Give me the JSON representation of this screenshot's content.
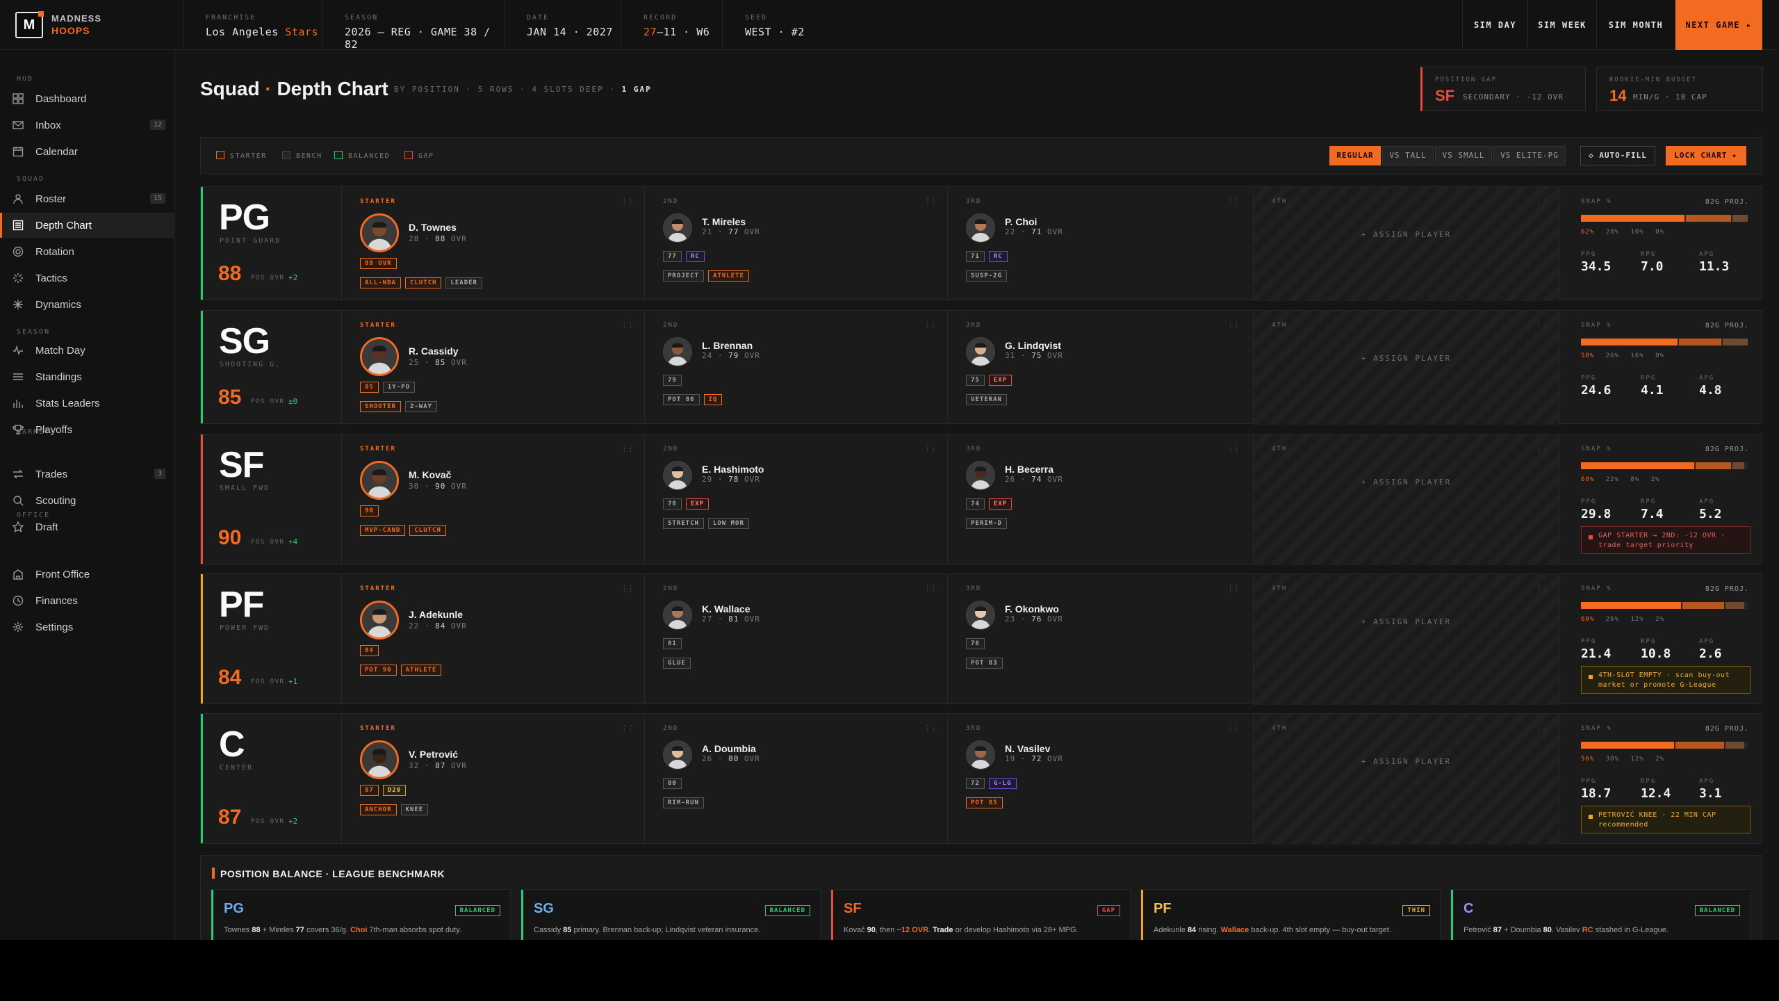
{
  "brand": {
    "line1": "MADNESS",
    "line2": "HOOPS",
    "logo": "M"
  },
  "meta": [
    {
      "label": "FRANCHISE",
      "value": "Los Angeles ",
      "accent": "Stars"
    },
    {
      "label": "SEASON",
      "value": "2026 — REG · GAME 38 / 82",
      "accent": ""
    },
    {
      "label": "DATE",
      "value": "JAN 14 · 2027",
      "accent": ""
    },
    {
      "label": "RECORD",
      "value": "—11 · W6",
      "accent": "27"
    },
    {
      "label": "SEED",
      "value": "WEST · #2",
      "accent": ""
    }
  ],
  "topbuttons": {
    "sim_day": "SIM DAY",
    "sim_week": "SIM WEEK",
    "sim_month": "SIM MONTH",
    "next_game": "NEXT GAME ▸"
  },
  "sidebar": {
    "sections": [
      "HUB",
      "SQUAD",
      "SEASON",
      "MARKET",
      "OFFICE"
    ],
    "items": [
      {
        "label": "Dashboard",
        "icon": "grid-icon",
        "count": ""
      },
      {
        "label": "Inbox",
        "icon": "mail-icon",
        "count": "12"
      },
      {
        "label": "Calendar",
        "icon": "calendar-icon",
        "count": ""
      },
      {
        "label": "Roster",
        "icon": "person-icon",
        "count": "15"
      },
      {
        "label": "Depth Chart",
        "icon": "list-icon",
        "count": ""
      },
      {
        "label": "Rotation",
        "icon": "rotation-icon",
        "count": ""
      },
      {
        "label": "Tactics",
        "icon": "tactics-icon",
        "count": ""
      },
      {
        "label": "Dynamics",
        "icon": "dynamics-icon",
        "count": ""
      },
      {
        "label": "Match Day",
        "icon": "pulse-icon",
        "count": ""
      },
      {
        "label": "Standings",
        "icon": "lines-icon",
        "count": ""
      },
      {
        "label": "Stats Leaders",
        "icon": "bars-icon",
        "count": ""
      },
      {
        "label": "Playoffs",
        "icon": "trophy-icon",
        "count": ""
      },
      {
        "label": "Trades",
        "icon": "swap-icon",
        "count": "3"
      },
      {
        "label": "Scouting",
        "icon": "search-icon",
        "count": ""
      },
      {
        "label": "Draft",
        "icon": "star-icon",
        "count": ""
      },
      {
        "label": "Front Office",
        "icon": "building-icon",
        "count": ""
      },
      {
        "label": "Finances",
        "icon": "clock-icon",
        "count": ""
      },
      {
        "label": "Settings",
        "icon": "gear-icon",
        "count": ""
      }
    ]
  },
  "header": {
    "title": "Squad",
    "title2": "Depth Chart",
    "sub": "BY POSITION · 5 ROWS · 4 SLOTS DEEP · ",
    "sub_b": "1 GAP"
  },
  "kpis": [
    {
      "label": "POSITION GAP",
      "value": "SF",
      "sub": "SECONDARY · -12 OVR"
    },
    {
      "label": "ROOKIE-MIN BUDGET",
      "value": "14",
      "sub": "MIN/G · 18 CAP"
    }
  ],
  "legend": {
    "starter": "STARTER",
    "bench": "BENCH",
    "balanced": "BALANCED",
    "gap": "GAP"
  },
  "views": [
    "REGULAR",
    "VS TALL",
    "VS SMALL",
    "VS ELITE-PG"
  ],
  "autofill": "◇ AUTO-FILL",
  "lock": "LOCK CHART ▸",
  "slot_labels": {
    "starter": "STARTER",
    "s2": "2ND",
    "s3": "3RD",
    "s4": "4TH",
    "assign": "+ ASSIGN PLAYER",
    "snap": "SNAP %",
    "proj": "82G PROJ.",
    "ppg": "PPG",
    "rpg": "RPG",
    "apg": "APG",
    "ovr_l": "POS OVR"
  },
  "rows": [
    {
      "pos": "PG",
      "name": "POINT GUARD",
      "ovr": "88",
      "delta": "+2",
      "color": "#2ecc71",
      "starter": {
        "name": "D. Townes",
        "meta": "28 · ",
        "ovr": "88",
        "tags1": [
          [
            "88 OVR",
            "o"
          ]
        ],
        "tags2": [
          [
            "ALL-NBA",
            "o"
          ],
          [
            "CLUTCH",
            "o"
          ],
          [
            "LEADER",
            "g"
          ]
        ]
      },
      "second": {
        "name": "T. Mireles",
        "meta": "21 · ",
        "ovr": "77",
        "tags1": [
          [
            "77",
            "g"
          ],
          [
            "RC",
            "p"
          ]
        ],
        "tags2": [
          [
            "PROJECT",
            "g"
          ],
          [
            "ATHLETE",
            "o"
          ]
        ]
      },
      "third": {
        "name": "P. Choi",
        "meta": "22 · ",
        "ovr": "71",
        "tags1": [
          [
            "71",
            "g"
          ],
          [
            "RC",
            "p"
          ]
        ],
        "tags2": [
          [
            "SUSP-2G",
            "g"
          ]
        ]
      },
      "snap": [
        "62%",
        "28%",
        "10%",
        "0%"
      ],
      "snap_fill": [
        0.62,
        0.28,
        0.1
      ],
      "ppg": "34.5",
      "rpg": "7.0",
      "apg": "11.3",
      "alert": "",
      "alert_t": ""
    },
    {
      "pos": "SG",
      "name": "SHOOTING G.",
      "ovr": "85",
      "delta": "±0",
      "color": "#2ecc71",
      "starter": {
        "name": "R. Cassidy",
        "meta": "25 · ",
        "ovr": "85",
        "tags1": [
          [
            "85",
            "o"
          ],
          [
            "1Y-PO",
            "g"
          ]
        ],
        "tags2": [
          [
            "SHOOTER",
            "o"
          ],
          [
            "2-WAY",
            "g"
          ]
        ]
      },
      "second": {
        "name": "L. Brennan",
        "meta": "24 · ",
        "ovr": "79",
        "tags1": [
          [
            "79",
            "g"
          ]
        ],
        "tags2": [
          [
            "POT 86",
            "g"
          ],
          [
            "IQ",
            "o"
          ]
        ]
      },
      "third": {
        "name": "G. Lindqvist",
        "meta": "31 · ",
        "ovr": "75",
        "tags1": [
          [
            "75",
            "g"
          ],
          [
            "EXP",
            "r"
          ]
        ],
        "tags2": [
          [
            "VETERAN",
            "g"
          ]
        ]
      },
      "snap": [
        "58%",
        "26%",
        "16%",
        "0%"
      ],
      "snap_fill": [
        0.58,
        0.26,
        0.16
      ],
      "ppg": "24.6",
      "rpg": "4.1",
      "apg": "4.8",
      "alert": "",
      "alert_t": ""
    },
    {
      "pos": "SF",
      "name": "SMALL FWD",
      "ovr": "90",
      "delta": "+4",
      "color": "#e74c3c",
      "starter": {
        "name": "M. Kovač",
        "meta": "30 · ",
        "ovr": "90",
        "tags1": [
          [
            "90",
            "o"
          ]
        ],
        "tags2": [
          [
            "MVP-CAND",
            "o"
          ],
          [
            "CLUTCH",
            "o"
          ]
        ]
      },
      "second": {
        "name": "E. Hashimoto",
        "meta": "29 · ",
        "ovr": "78",
        "tags1": [
          [
            "78",
            "g"
          ],
          [
            "EXP",
            "r"
          ]
        ],
        "tags2": [
          [
            "STRETCH",
            "g"
          ],
          [
            "LOW MOR",
            "g"
          ]
        ]
      },
      "third": {
        "name": "H. Becerra",
        "meta": "26 · ",
        "ovr": "74",
        "tags1": [
          [
            "74",
            "g"
          ],
          [
            "EXP",
            "r"
          ]
        ],
        "tags2": [
          [
            "PERIM-D",
            "g"
          ]
        ]
      },
      "snap": [
        "68%",
        "22%",
        "8%",
        "2%"
      ],
      "snap_fill": [
        0.68,
        0.22,
        0.08
      ],
      "ppg": "29.8",
      "rpg": "7.4",
      "apg": "5.2",
      "alert": "r",
      "alert_t": "GAP STARTER → 2ND: -12 OVR · trade target priority"
    },
    {
      "pos": "PF",
      "name": "POWER FWD",
      "ovr": "84",
      "delta": "+1",
      "color": "#f2a51e",
      "starter": {
        "name": "J. Adekunle",
        "meta": "22 · ",
        "ovr": "84",
        "tags1": [
          [
            "84",
            "o"
          ]
        ],
        "tags2": [
          [
            "POT 90",
            "o"
          ],
          [
            "ATHLETE",
            "o"
          ]
        ]
      },
      "second": {
        "name": "K. Wallace",
        "meta": "27 · ",
        "ovr": "81",
        "tags1": [
          [
            "81",
            "g"
          ]
        ],
        "tags2": [
          [
            "GLUE",
            "g"
          ]
        ]
      },
      "third": {
        "name": "F. Okonkwo",
        "meta": "23 · ",
        "ovr": "76",
        "tags1": [
          [
            "76",
            "g"
          ]
        ],
        "tags2": [
          [
            "POT 83",
            "g"
          ]
        ]
      },
      "snap": [
        "60%",
        "26%",
        "12%",
        "2%"
      ],
      "snap_fill": [
        0.6,
        0.26,
        0.12
      ],
      "ppg": "21.4",
      "rpg": "10.8",
      "apg": "2.6",
      "alert": "y",
      "alert_t": "4TH-SLOT EMPTY · scan buy-out market or promote G-League"
    },
    {
      "pos": "C",
      "name": "CENTER",
      "ovr": "87",
      "delta": "+2",
      "color": "#2ecc71",
      "starter": {
        "name": "V. Petrović",
        "meta": "32 · ",
        "ovr": "87",
        "tags1": [
          [
            "87",
            "o"
          ],
          [
            "D20",
            "y"
          ]
        ],
        "tags2": [
          [
            "ANCHOR",
            "o"
          ],
          [
            "KNEE",
            "g"
          ]
        ]
      },
      "second": {
        "name": "A. Doumbia",
        "meta": "26 · ",
        "ovr": "80",
        "tags1": [
          [
            "80",
            "g"
          ]
        ],
        "tags2": [
          [
            "RIM-RUN",
            "g"
          ]
        ]
      },
      "third": {
        "name": "N. Vasilev",
        "meta": "19 · ",
        "ovr": "72",
        "tags1": [
          [
            "72",
            "g"
          ],
          [
            "G-LG",
            "p"
          ]
        ],
        "tags2": [
          [
            "POT 85",
            "o"
          ]
        ]
      },
      "snap": [
        "56%",
        "30%",
        "12%",
        "2%"
      ],
      "snap_fill": [
        0.56,
        0.3,
        0.12
      ],
      "ppg": "18.7",
      "rpg": "12.4",
      "apg": "3.1",
      "alert": "y",
      "alert_t": "PETROVIĆ KNEE · 22 MIN CAP recommended"
    }
  ],
  "balance": {
    "title": "POSITION BALANCE · LEAGUE BENCHMARK",
    "cards": [
      {
        "pos": "PG",
        "badge": "BALANCED",
        "color": "#6ab0f3",
        "bar": "#2ecc71",
        "bc": "#2ecc71",
        "html": "Townes <b>88</b> + Mireles <b>77</b> covers 36/g. <em>Choi</em> 7th-man absorbs spot duty."
      },
      {
        "pos": "SG",
        "badge": "BALANCED",
        "color": "#6ab0f3",
        "bar": "#2ecc71",
        "bc": "#2ecc71",
        "html": "Cassidy <b>85</b> primary. Brennan back-up; Lindqvist veteran insurance."
      },
      {
        "pos": "SF",
        "badge": "GAP",
        "color": "#f26b21",
        "bar": "#e74c3c",
        "bc": "#e74c3c",
        "html": "Kovač <b>90</b>, then <em>−12 OVR</em>. <b>Trade</b> or develop Hashimoto via 28+ MPG."
      },
      {
        "pos": "PF",
        "badge": "THIN",
        "color": "#f2c14e",
        "bar": "#f2a51e",
        "bc": "#f2a51e",
        "html": "Adekunle <b>84</b> rising. <em>Wallace</em> back-up. 4th slot empty — buy-out target."
      },
      {
        "pos": "C",
        "badge": "BALANCED",
        "color": "#a48cff",
        "bar": "#2ecc71",
        "bc": "#2ecc71",
        "html": "Petrović <b>87</b> + Doumbia <b>80</b>. Vasilev <em>RC</em> stashed in G-League."
      }
    ]
  }
}
